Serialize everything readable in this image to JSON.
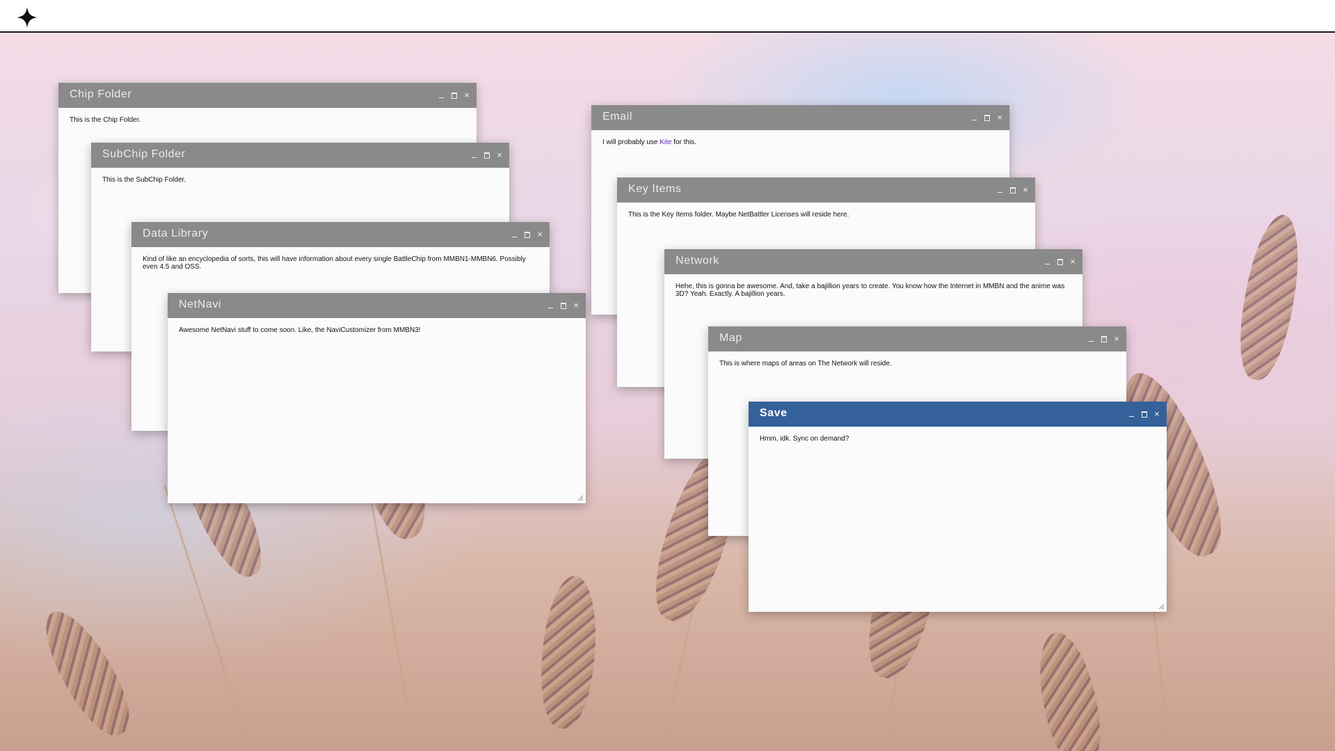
{
  "topbar": {
    "logo_icon": "sparkle-star-icon"
  },
  "windows": {
    "chip_folder": {
      "title": "Chip Folder",
      "content": "This is the Chip Folder."
    },
    "subchip_folder": {
      "title": "SubChip Folder",
      "content": "This is the SubChip Folder."
    },
    "data_library": {
      "title": "Data Library",
      "content": "Kind of like an encyclopedia of sorts, this will have information about every single BattleChip from MMBN1-MMBN6. Possibly even 4.5 and OSS."
    },
    "netnavi": {
      "title": "NetNavi",
      "content": "Awesome NetNavi stuff to come soon. Like, the NaviCustomizer from MMBN3!"
    },
    "email": {
      "title": "Email",
      "content_before": "I will probably use ",
      "link": "Kite",
      "content_after": " for this."
    },
    "key_items": {
      "title": "Key Items",
      "content": "This is the Key Items folder. Maybe NetBattler Licenses will reside here."
    },
    "network": {
      "title": "Network",
      "content": "Hehe, this is gonna be awesome. And, take a bajillion years to create. You know how the Internet in MMBN and the anime was 3D? Yeah. Exactly. A bajillion years."
    },
    "map": {
      "title": "Map",
      "content": "This is where maps of areas on The Network will reside."
    },
    "save": {
      "title": "Save",
      "content": "Hmm, idk. Sync on demand?"
    }
  },
  "window_controls": {
    "minimize": "_",
    "maximize": "□",
    "close": "×"
  },
  "colors": {
    "titlebar_inactive": "#8a8a8a",
    "titlebar_active": "#35619a",
    "window_bg": "#fbfbfb",
    "link": "#6b2fa8"
  }
}
